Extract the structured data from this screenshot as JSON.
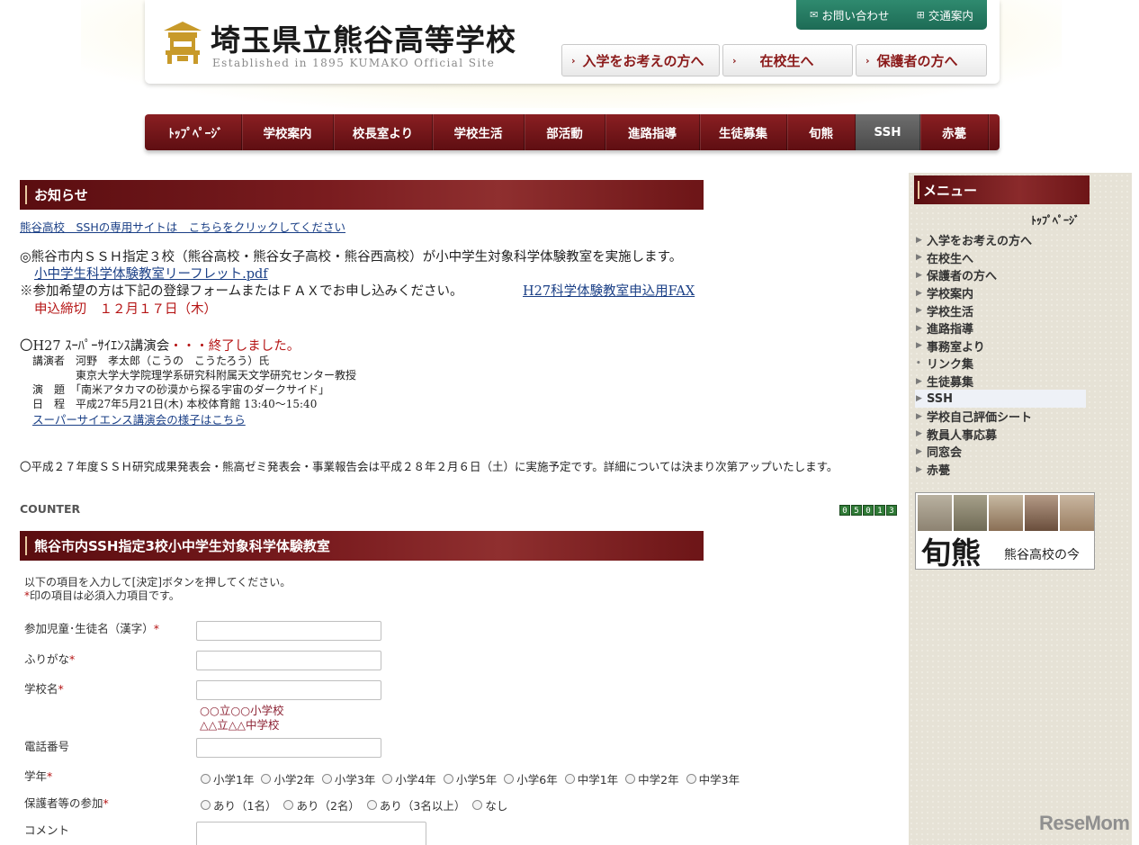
{
  "header": {
    "school_name": "埼玉県立熊谷高等学校",
    "subtitle": "Established in 1895  KUMAKO Official Site",
    "utility": [
      {
        "label": "お問い合わせ",
        "icon": "mail-icon"
      },
      {
        "label": "交通案内",
        "icon": "map-icon"
      }
    ],
    "audience_buttons": [
      "入学をお考えの方へ",
      "在校生へ",
      "保護者の方へ"
    ]
  },
  "gnav": {
    "items": [
      "ﾄｯﾌﾟﾍﾟｰｼﾞ",
      "学校案内",
      "校長室より",
      "学校生活",
      "部活動",
      "進路指導",
      "生徒募集",
      "旬熊",
      "SSH",
      "赤甍"
    ],
    "active_index": 8
  },
  "notice": {
    "heading": "お知らせ",
    "ssh_site_link": "熊谷高校　SSHの専用サイトは　こちらをクリックしてください",
    "item1_text": "◎熊谷市内ＳＳＨ指定３校（熊谷高校・熊谷女子高校・熊谷西高校）が小中学生対象科学体験教室を実施します。",
    "leaflet_link": "小中学生科学体験教室リーフレット.pdf",
    "apply_text": "※参加希望の方は下記の登録フォームまたはＦＡＸでお申し込みください。",
    "fax_link": "H27科学体験教室申込用FAX",
    "deadline": "申込締切　１２月１７日（木）",
    "lecture_title": "〇H27 ｽｰﾊﾟｰｻｲｴﾝｽ講演会",
    "lecture_done": "・・・終了しました。",
    "lecture_lines": [
      "講演者　河野　孝太郎（こうの　こうたろう）氏",
      "　　　　東京大学大学院理学系研究科附属天文学研究センター教授",
      "演　題　「南米アタカマの砂漠から探る宇宙のダークサイド」",
      "日　程　平成27年5月21日(木) 本校体育館 13:40～15:40"
    ],
    "lecture_link": "スーパーサイエンス講演会の様子はこちら",
    "report_text": "〇平成２７年度ＳＳＨ研究成果発表会・熊高ゼミ発表会・事業報告会は平成２８年２月６日（土）に実施予定です。詳細については決まり次第アップいたします。",
    "counter_label": "COUNTER",
    "counter_digits": [
      "0",
      "5",
      "0",
      "1",
      "3"
    ]
  },
  "form": {
    "heading": "熊谷市内SSH指定3校小中学生対象科学体験教室",
    "intro1": "以下の項目を入力して[決定]ボタンを押してください。",
    "intro2_star": "*",
    "intro2": "印の項目は必須入力項目です。",
    "required_mark": "*",
    "fields": {
      "name": "参加児童･生徒名（漢字）",
      "furigana": "ふりがな",
      "school": "学校名",
      "phone": "電話番号",
      "grade": "学年",
      "guardian": "保護者等の参加",
      "comment": "コメント"
    },
    "school_hints": [
      "○○立○○小学校",
      "△△立△△中学校"
    ],
    "grade_options": [
      "小学1年",
      "小学2年",
      "小学3年",
      "小学4年",
      "小学5年",
      "小学6年",
      "中学1年",
      "中学2年",
      "中学3年"
    ],
    "guardian_options": [
      "あり（1名）",
      "あり（2名）",
      "あり（3名以上）",
      "なし"
    ]
  },
  "sidebar": {
    "heading": "メニュー",
    "top_link": "ﾄｯﾌﾟﾍﾟｰｼﾞ",
    "items": [
      "入学をお考えの方へ",
      "在校生へ",
      "保護者の方へ",
      "学校案内",
      "学校生活",
      "進路指導",
      "事務室より",
      "リンク集",
      "生徒募集",
      "SSH",
      "学校自己評価シート",
      "教員人事応募",
      "同窓会",
      "赤甍"
    ],
    "active_index": 9,
    "banner_big": "旬熊",
    "banner_small": "熊谷高校の今"
  },
  "watermark": "ReseMom"
}
